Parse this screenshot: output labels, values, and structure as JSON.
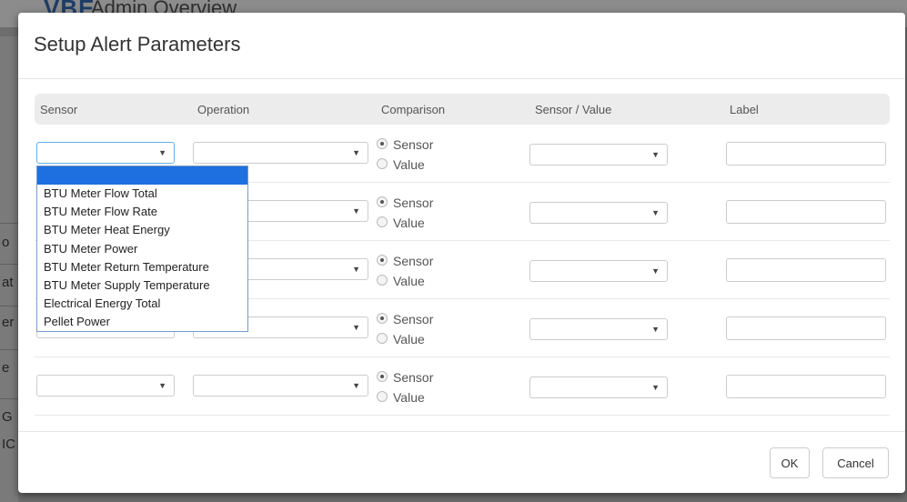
{
  "background": {
    "logo": "VBE",
    "title": "Admin Overview",
    "side_fragments": [
      "o",
      "at",
      "er",
      "e",
      "G",
      "IC"
    ]
  },
  "modal": {
    "title": "Setup Alert Parameters",
    "columns": [
      "Sensor",
      "Operation",
      "Comparison",
      "Sensor / Value",
      "Label"
    ],
    "radio_labels": {
      "sensor": "Sensor",
      "value": "Value"
    },
    "selected_comparison": "Sensor",
    "rows": 5
  },
  "dropdown": {
    "open_on_row": 1,
    "items": [
      "",
      "BTU Meter Flow Total",
      "BTU Meter Flow Rate",
      "BTU Meter Heat Energy",
      "BTU Meter Power",
      "BTU Meter Return Temperature",
      "BTU Meter Supply Temperature",
      "Electrical Energy Total",
      "Pellet Power"
    ]
  },
  "footer": {
    "ok_label": "OK",
    "cancel_label": "Cancel"
  },
  "colors": {
    "highlight": "#1e6fe0",
    "focus_border": "#66afe9"
  }
}
